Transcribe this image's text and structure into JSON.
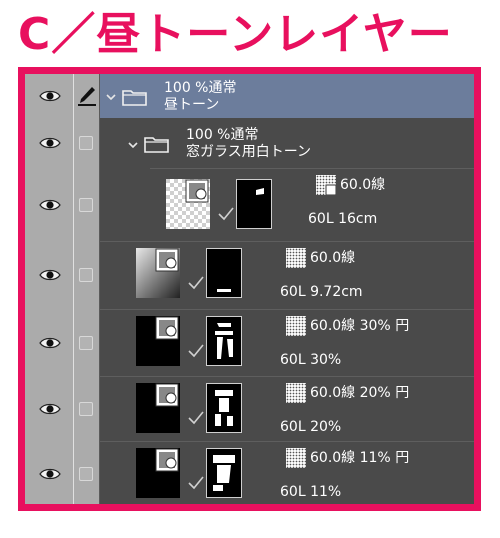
{
  "heading": "C／昼トーンレイヤー",
  "colors": {
    "accent": "#e8105e",
    "panel": "#4a4a4a",
    "selected_row": "#6c7d9c",
    "column_bg": "#ababab"
  },
  "icons": {
    "visibility": "eye-icon",
    "lock": "checkbox-icon",
    "edit": "pen-icon",
    "folder": "folder-icon",
    "expand": "chevron-down-icon",
    "link": "check-mark-icon",
    "tone": "checker-icon"
  },
  "layers": [
    {
      "kind": "folder",
      "line1": "100 %通常",
      "line2": "昼トーン",
      "selected": true
    },
    {
      "kind": "folder",
      "line1": "100 %通常",
      "line2": "窓ガラス用白トーン",
      "selected": false
    },
    {
      "kind": "tone",
      "tone": "60.0線",
      "detail": "60L 16cm"
    },
    {
      "kind": "tone",
      "tone": "60.0線",
      "detail": "60L 9.72cm"
    },
    {
      "kind": "tone",
      "tone": "60.0線 30% 円",
      "detail": "60L 30%"
    },
    {
      "kind": "tone",
      "tone": "60.0線 20% 円",
      "detail": "60L 20%"
    },
    {
      "kind": "tone",
      "tone": "60.0線 11% 円",
      "detail": "60L 11%"
    }
  ]
}
